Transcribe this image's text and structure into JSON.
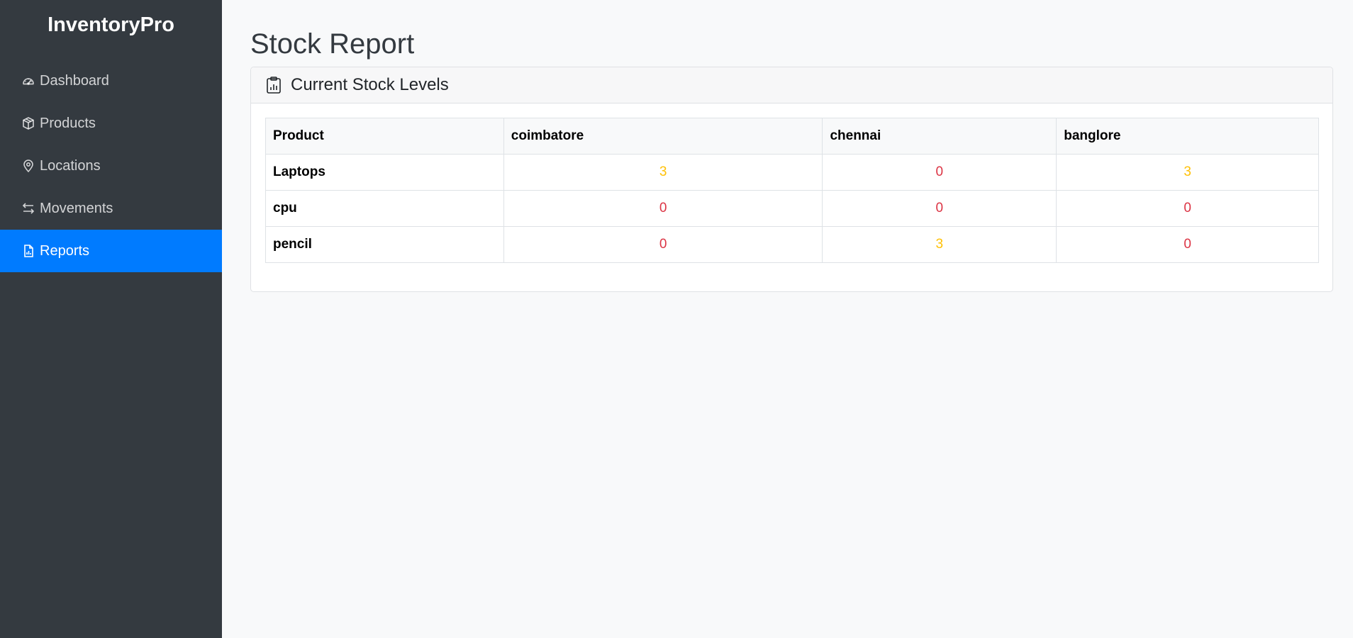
{
  "brand": "InventoryPro",
  "nav": [
    {
      "label": "Dashboard",
      "icon": "speedometer-icon",
      "active": false
    },
    {
      "label": "Products",
      "icon": "box-icon",
      "active": false
    },
    {
      "label": "Locations",
      "icon": "map-pin-icon",
      "active": false
    },
    {
      "label": "Movements",
      "icon": "arrows-exchange-icon",
      "active": false
    },
    {
      "label": "Reports",
      "icon": "report-file-icon",
      "active": true
    }
  ],
  "page_title": "Stock Report",
  "card": {
    "title": "Current Stock Levels",
    "icon": "clipboard-chart-icon"
  },
  "table": {
    "headers": [
      "Product",
      "coimbatore",
      "chennai",
      "banglore"
    ],
    "rows": [
      {
        "product": "Laptops",
        "values": [
          "3",
          "0",
          "3"
        ]
      },
      {
        "product": "cpu",
        "values": [
          "0",
          "0",
          "0"
        ]
      },
      {
        "product": "pencil",
        "values": [
          "0",
          "3",
          "0"
        ]
      }
    ]
  },
  "colors": {
    "sidebar_bg": "#343a40",
    "active_bg": "#007bff",
    "low_stock": "#ffc107",
    "no_stock": "#dc3545"
  }
}
